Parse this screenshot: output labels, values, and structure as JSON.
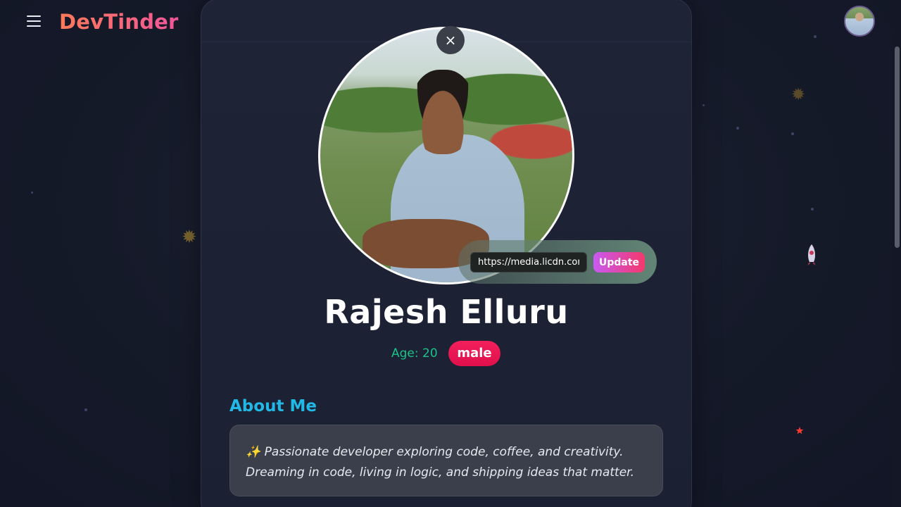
{
  "navbar": {
    "brand": "DevTinder",
    "menu_icon": "hamburger-menu-icon",
    "avatar_icon": "user-avatar"
  },
  "profile": {
    "close_icon": "close-icon",
    "close_glyph": "×",
    "photo_url_value": "https://media.licdn.com",
    "update_label": "Update",
    "name": "Rajesh Elluru",
    "age_text": "Age: 20",
    "gender": "male"
  },
  "about": {
    "title": "About Me",
    "line1": "✨ Passionate developer exploring code, coffee, and creativity.",
    "line2": "Dreaming in code, living in logic, and shipping ideas that matter."
  },
  "decorations": {
    "gear_left": "gear-icon",
    "gear_right": "gear-icon",
    "rocket": "rocket-icon",
    "moon": "moon-star-icon"
  },
  "colors": {
    "brand_gradient_start": "#ff7a59",
    "brand_gradient_end": "#f3569a",
    "age": "#1bc28a",
    "gender_badge": "#f21f5b",
    "about_title": "#22b8e6",
    "update_gradient_start": "#c85af2",
    "update_gradient_end": "#f4386b"
  }
}
